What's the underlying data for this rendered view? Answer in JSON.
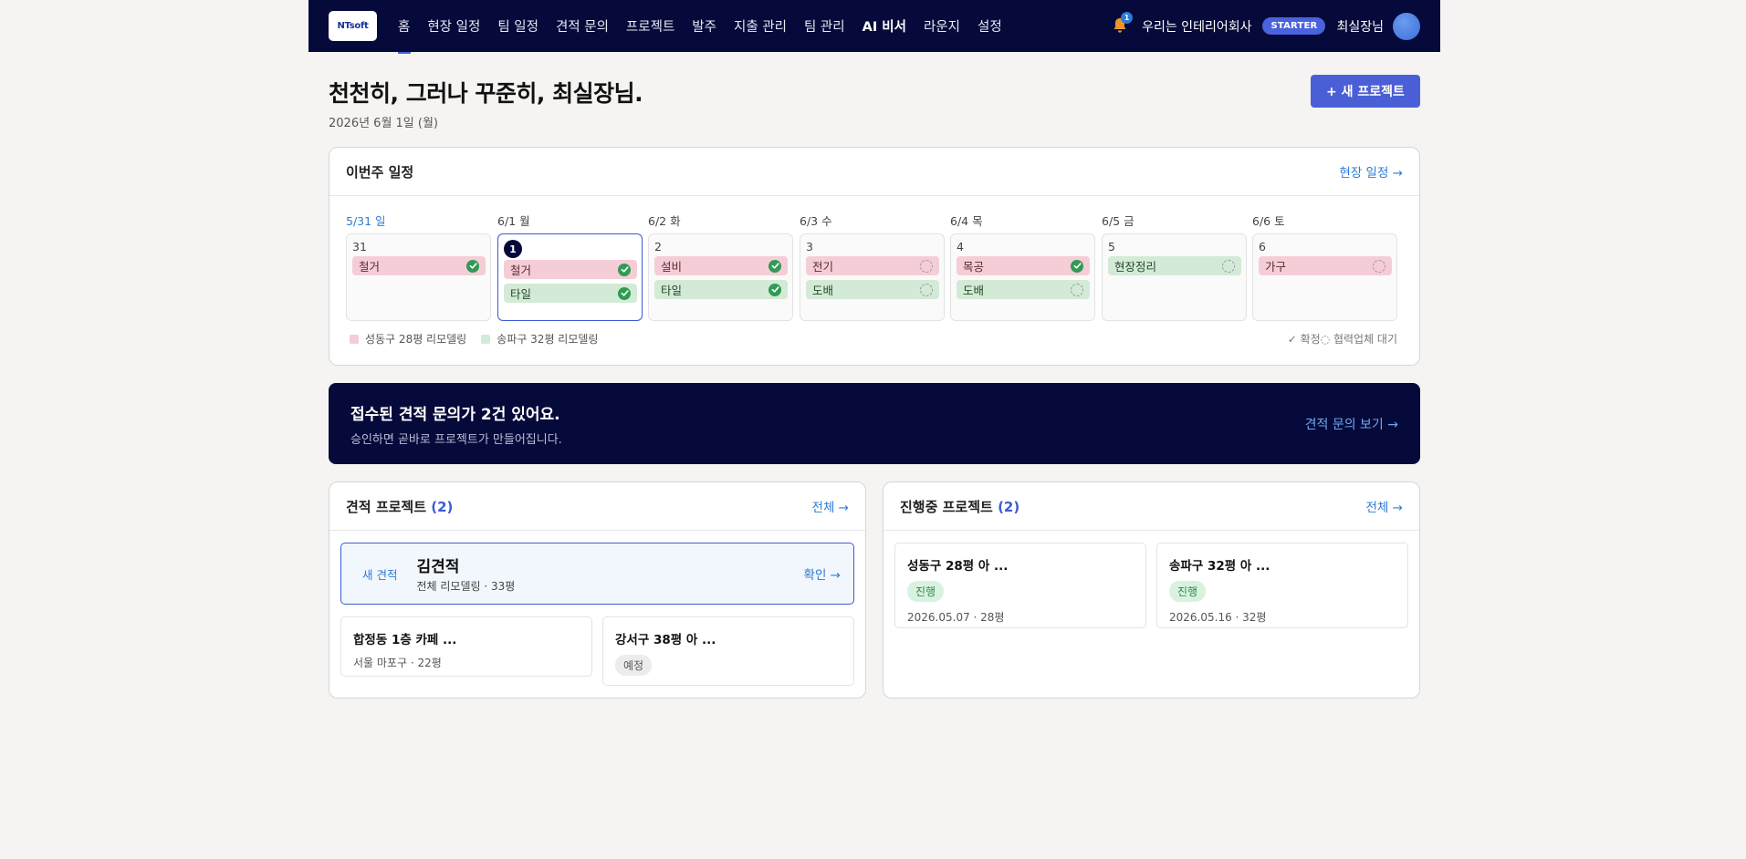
{
  "nav": {
    "logo": "NTsoft",
    "items": [
      "홈",
      "현장 일정",
      "팀 일정",
      "견적 문의",
      "프로젝트",
      "발주",
      "지출 관리",
      "팀 관리",
      "AI 비서",
      "라운지",
      "설정"
    ],
    "notification_count": "1",
    "company": "우리는 인테리어회사",
    "plan": "STARTER",
    "user": "최실장님"
  },
  "header": {
    "title": "천천히, 그러나 꾸준히, 최실장님.",
    "date": "2026년 6월 1일 (월)",
    "new_project_label": "+ 새 프로젝트"
  },
  "week": {
    "title": "이번주 일정",
    "link": "현장 일정 →",
    "days": [
      {
        "label": "5/31 일",
        "num": "31",
        "tasks": [
          {
            "name": "철거",
            "color": "pink",
            "status": "done"
          }
        ]
      },
      {
        "label": "6/1 월",
        "num": "1",
        "tasks": [
          {
            "name": "철거",
            "color": "pink",
            "status": "done"
          },
          {
            "name": "타일",
            "color": "green",
            "status": "done"
          }
        ]
      },
      {
        "label": "6/2 화",
        "num": "2",
        "tasks": [
          {
            "name": "설비",
            "color": "pink",
            "status": "done"
          },
          {
            "name": "타일",
            "color": "green",
            "status": "done"
          }
        ]
      },
      {
        "label": "6/3 수",
        "num": "3",
        "tasks": [
          {
            "name": "전기",
            "color": "pink",
            "status": "wait"
          },
          {
            "name": "도배",
            "color": "green",
            "status": "wait"
          }
        ]
      },
      {
        "label": "6/4 목",
        "num": "4",
        "tasks": [
          {
            "name": "목공",
            "color": "pink",
            "status": "done"
          },
          {
            "name": "도배",
            "color": "green",
            "status": "wait"
          }
        ]
      },
      {
        "label": "6/5 금",
        "num": "5",
        "tasks": [
          {
            "name": "현장정리",
            "color": "green",
            "status": "wait"
          }
        ]
      },
      {
        "label": "6/6 토",
        "num": "6",
        "tasks": [
          {
            "name": "가구",
            "color": "pink",
            "status": "wait"
          }
        ]
      }
    ],
    "legend": [
      {
        "name": "성동구 28평 리모델링",
        "color": "#f5cdd6"
      },
      {
        "name": "송파구 32평 리모델링",
        "color": "#d3ead6"
      }
    ],
    "status_legend": "✓ 확정◌ 협력업체 대기"
  },
  "banner": {
    "title": "접수된 견적 문의가 2건 있어요.",
    "subtitle": "승인하면 곧바로 프로젝트가 만들어집니다.",
    "link": "견적 문의 보기 →"
  },
  "estimates": {
    "title": "견적 프로젝트",
    "count": "(2)",
    "link": "전체 →",
    "new": {
      "tag": "새 견적",
      "name": "김견적",
      "sub": "전체 리모델링 · 33평",
      "link": "확인 →"
    },
    "items": [
      {
        "name": "합정동 1층 카페 ...",
        "sub": "서울 마포구 · 22평"
      },
      {
        "name": "강서구 38평 아 ...",
        "badge": "예정"
      }
    ]
  },
  "progress": {
    "title": "진행중 프로젝트",
    "count": "(2)",
    "link": "전체 →",
    "items": [
      {
        "name": "성동구 28평 아 ...",
        "badge": "진행",
        "sub": "2026.05.07 · 28평"
      },
      {
        "name": "송파구 32평 아 ...",
        "badge": "진행",
        "sub": "2026.05.16 · 32평"
      }
    ]
  }
}
